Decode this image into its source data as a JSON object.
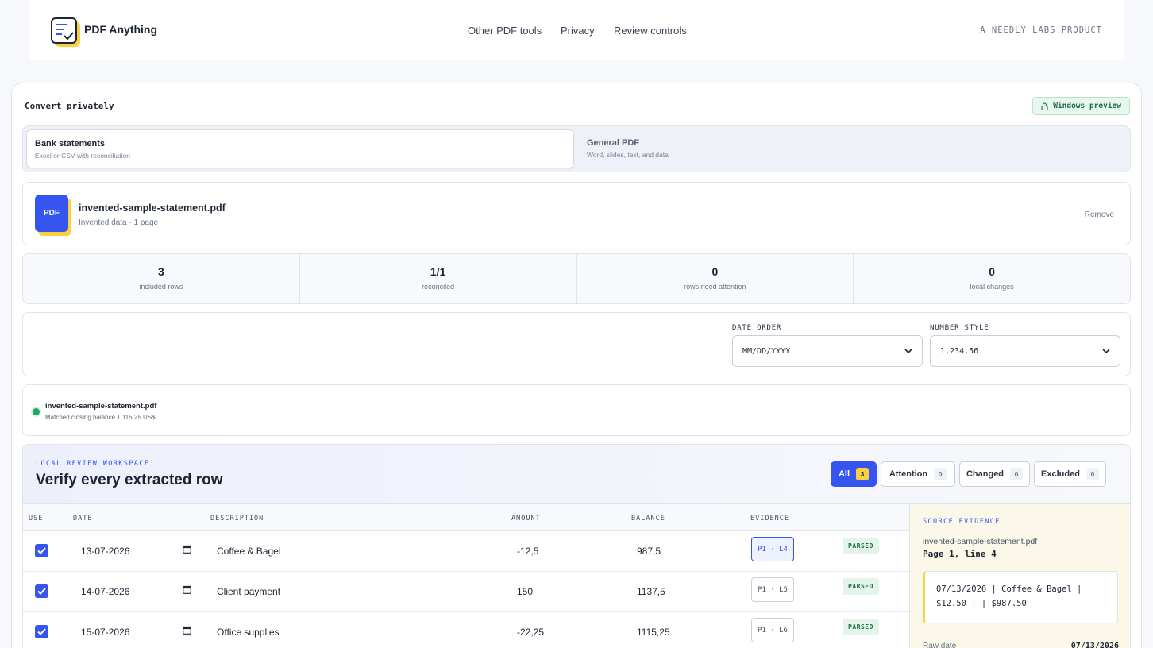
{
  "header": {
    "brand": "PDF Anything",
    "nav": [
      "Other PDF tools",
      "Privacy",
      "Review controls"
    ],
    "tagline": "A NEEDLY LABS PRODUCT"
  },
  "card": {
    "title": "Convert privately",
    "badge": "Windows preview"
  },
  "modes": [
    {
      "title": "Bank statements",
      "subtitle": "Excel or CSV with reconciliation",
      "active": true
    },
    {
      "title": "General PDF",
      "subtitle": "Word, slides, text, and data",
      "active": false
    }
  ],
  "file": {
    "icon_label": "PDF",
    "name": "invented-sample-statement.pdf",
    "meta": "Invented data · 1 page",
    "remove_label": "Remove"
  },
  "stats": [
    {
      "value": "3",
      "label": "included rows"
    },
    {
      "value": "1/1",
      "label": "reconciled"
    },
    {
      "value": "0",
      "label": "rows need attention"
    },
    {
      "value": "0",
      "label": "local changes"
    }
  ],
  "options": {
    "date_order_label": "DATE ORDER",
    "date_order_value": "MM/DD/YYYY",
    "number_style_label": "NUMBER STYLE",
    "number_style_value": "1,234.56"
  },
  "reconciliation": {
    "file": "invented-sample-statement.pdf",
    "message": "Matched closing balance 1.115,25 US$"
  },
  "workspace": {
    "kicker": "LOCAL REVIEW WORKSPACE",
    "title": "Verify every extracted row",
    "filters": [
      {
        "label": "All",
        "count": "3",
        "active": true
      },
      {
        "label": "Attention",
        "count": "0",
        "active": false
      },
      {
        "label": "Changed",
        "count": "0",
        "active": false
      },
      {
        "label": "Excluded",
        "count": "0",
        "active": false
      }
    ],
    "columns": {
      "use": "USE",
      "date": "DATE",
      "description": "DESCRIPTION",
      "amount": "AMOUNT",
      "balance": "BALANCE",
      "evidence": "EVIDENCE"
    },
    "rows": [
      {
        "date": "13-07-2026",
        "description": "Coffee & Bagel",
        "amount": "-12,5",
        "balance": "987,5",
        "evidence": "P1 · L4",
        "status": "PARSED",
        "checked": true
      },
      {
        "date": "14-07-2026",
        "description": "Client payment",
        "amount": "150",
        "balance": "1137,5",
        "evidence": "P1 · L5",
        "status": "PARSED",
        "checked": true
      },
      {
        "date": "15-07-2026",
        "description": "Office supplies",
        "amount": "-22,25",
        "balance": "1115,25",
        "evidence": "P1 · L6",
        "status": "PARSED",
        "checked": true
      }
    ]
  },
  "evidence": {
    "kicker": "SOURCE EVIDENCE",
    "file": "invented-sample-statement.pdf",
    "location": "Page 1, line 4",
    "raw_line": "07/13/2026 | Coffee & Bagel | $12.50 | | $987.50",
    "raw_date_label": "Raw date",
    "raw_date_value": "07/13/2026"
  },
  "colors": {
    "accent": "#3554f0",
    "highlight": "#f7d23e",
    "success": "#27a36a"
  }
}
